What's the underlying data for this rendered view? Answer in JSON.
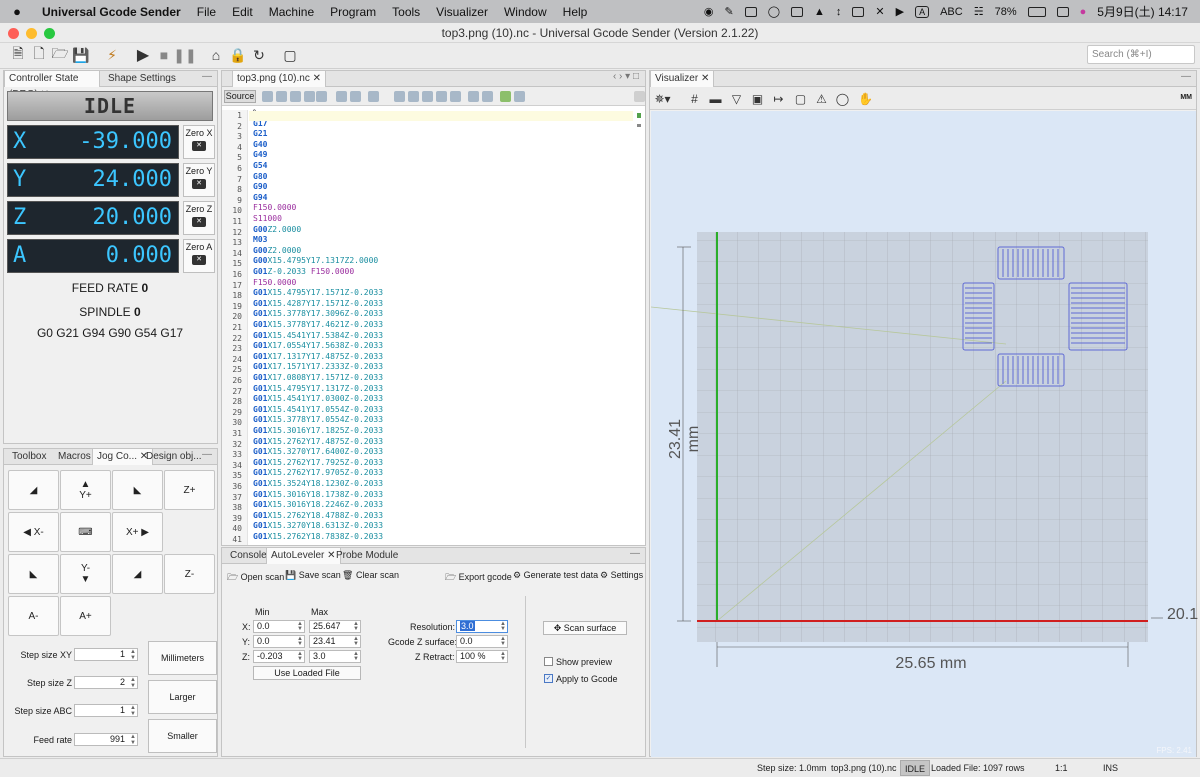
{
  "menubar": {
    "app_name": "Universal Gcode Sender",
    "items": [
      "File",
      "Edit",
      "Machine",
      "Program",
      "Tools",
      "Visualizer",
      "Window",
      "Help"
    ],
    "input_mode": "ABC",
    "battery": "78%",
    "clock": "5月9日(土)  14:17"
  },
  "window": {
    "title": "top3.png (10).nc - Universal Gcode Sender (Version 2.1.22)"
  },
  "toolbar": {
    "search_placeholder": "Search (⌘+I)"
  },
  "left_top": {
    "tabs": [
      "Controller State (DRO)",
      "Shape Settings"
    ],
    "state": "IDLE",
    "axes": [
      {
        "name": "X",
        "value": "-39.000",
        "zero_label": "Zero X"
      },
      {
        "name": "Y",
        "value": "24.000",
        "zero_label": "Zero Y"
      },
      {
        "name": "Z",
        "value": "20.000",
        "zero_label": "Zero Z"
      },
      {
        "name": "A",
        "value": "0.000",
        "zero_label": "Zero A"
      }
    ],
    "feed_rate_label": "FEED RATE",
    "feed_rate_value": "0",
    "spindle_label": "SPINDLE",
    "spindle_value": "0",
    "gcode_state": "G0 G21 G94 G90 G54 G17"
  },
  "left_bottom": {
    "tabs": [
      "Toolbox",
      "Macros",
      "Jog Co...",
      "Design obj..."
    ],
    "jog": {
      "y_plus": "Y+",
      "z_plus": "Z+",
      "x_minus": "X-",
      "x_plus": "X+",
      "y_minus": "Y-",
      "z_minus": "Z-",
      "a_minus": "A-",
      "a_plus": "A+"
    },
    "step_xy_label": "Step size XY",
    "step_xy": "1",
    "step_z_label": "Step size Z",
    "step_z": "2",
    "step_abc_label": "Step size ABC",
    "step_abc": "1",
    "feed_label": "Feed rate",
    "feed": "991",
    "millimeters": "Millimeters",
    "larger": "Larger",
    "smaller": "Smaller"
  },
  "editor": {
    "tab": "top3.png (10).nc",
    "source_button": "Source",
    "lines": [
      {
        "n": "1",
        "parts": [
          {
            "t": "%",
            "c": ""
          }
        ]
      },
      {
        "n": "2",
        "parts": [
          {
            "t": "G17",
            "c": "kw"
          }
        ]
      },
      {
        "n": "3",
        "parts": [
          {
            "t": "G21",
            "c": "kw"
          }
        ]
      },
      {
        "n": "4",
        "parts": [
          {
            "t": "G40",
            "c": "kw"
          }
        ]
      },
      {
        "n": "5",
        "parts": [
          {
            "t": "G49",
            "c": "kw"
          }
        ]
      },
      {
        "n": "6",
        "parts": [
          {
            "t": "G54",
            "c": "kw"
          }
        ]
      },
      {
        "n": "7",
        "parts": [
          {
            "t": "G80",
            "c": "kw"
          }
        ]
      },
      {
        "n": "8",
        "parts": [
          {
            "t": "G90",
            "c": "kw"
          }
        ]
      },
      {
        "n": "9",
        "parts": [
          {
            "t": "G94",
            "c": "kw"
          }
        ]
      },
      {
        "n": "10",
        "parts": [
          {
            "t": "F150.0000",
            "c": "fs"
          }
        ]
      },
      {
        "n": "11",
        "parts": [
          {
            "t": "S11000",
            "c": "fs"
          }
        ]
      },
      {
        "n": "12",
        "parts": [
          {
            "t": "G00",
            "c": "kw"
          },
          {
            "t": "Z2.0000",
            "c": "arg"
          }
        ]
      },
      {
        "n": "13",
        "parts": [
          {
            "t": "M03",
            "c": "kw"
          }
        ]
      },
      {
        "n": "14",
        "parts": [
          {
            "t": "G00",
            "c": "kw"
          },
          {
            "t": "Z2.0000",
            "c": "arg"
          }
        ]
      },
      {
        "n": "15",
        "parts": [
          {
            "t": "G00",
            "c": "kw"
          },
          {
            "t": "X15.4795Y17.1317Z2.0000",
            "c": "arg"
          }
        ]
      },
      {
        "n": "16",
        "parts": [
          {
            "t": "G01",
            "c": "kw"
          },
          {
            "t": "Z-0.2033 ",
            "c": "arg"
          },
          {
            "t": "F150.0000",
            "c": "fs"
          }
        ]
      },
      {
        "n": "17",
        "parts": [
          {
            "t": "F150.0000",
            "c": "fs"
          }
        ]
      },
      {
        "n": "18",
        "parts": [
          {
            "t": "G01",
            "c": "kw"
          },
          {
            "t": "X15.4795Y17.1571Z-0.2033",
            "c": "arg"
          }
        ]
      },
      {
        "n": "19",
        "parts": [
          {
            "t": "G01",
            "c": "kw"
          },
          {
            "t": "X15.4287Y17.1571Z-0.2033",
            "c": "arg"
          }
        ]
      },
      {
        "n": "20",
        "parts": [
          {
            "t": "G01",
            "c": "kw"
          },
          {
            "t": "X15.3778Y17.3096Z-0.2033",
            "c": "arg"
          }
        ]
      },
      {
        "n": "21",
        "parts": [
          {
            "t": "G01",
            "c": "kw"
          },
          {
            "t": "X15.3778Y17.4621Z-0.2033",
            "c": "arg"
          }
        ]
      },
      {
        "n": "22",
        "parts": [
          {
            "t": "G01",
            "c": "kw"
          },
          {
            "t": "X15.4541Y17.5384Z-0.2033",
            "c": "arg"
          }
        ]
      },
      {
        "n": "23",
        "parts": [
          {
            "t": "G01",
            "c": "kw"
          },
          {
            "t": "X17.0554Y17.5638Z-0.2033",
            "c": "arg"
          }
        ]
      },
      {
        "n": "24",
        "parts": [
          {
            "t": "G01",
            "c": "kw"
          },
          {
            "t": "X17.1317Y17.4875Z-0.2033",
            "c": "arg"
          }
        ]
      },
      {
        "n": "25",
        "parts": [
          {
            "t": "G01",
            "c": "kw"
          },
          {
            "t": "X17.1571Y17.2333Z-0.2033",
            "c": "arg"
          }
        ]
      },
      {
        "n": "26",
        "parts": [
          {
            "t": "G01",
            "c": "kw"
          },
          {
            "t": "X17.0808Y17.1571Z-0.2033",
            "c": "arg"
          }
        ]
      },
      {
        "n": "27",
        "parts": [
          {
            "t": "G01",
            "c": "kw"
          },
          {
            "t": "X15.4795Y17.1317Z-0.2033",
            "c": "arg"
          }
        ]
      },
      {
        "n": "28",
        "parts": [
          {
            "t": "G01",
            "c": "kw"
          },
          {
            "t": "X15.4541Y17.0300Z-0.2033",
            "c": "arg"
          }
        ]
      },
      {
        "n": "29",
        "parts": [
          {
            "t": "G01",
            "c": "kw"
          },
          {
            "t": "X15.4541Y17.0554Z-0.2033",
            "c": "arg"
          }
        ]
      },
      {
        "n": "30",
        "parts": [
          {
            "t": "G01",
            "c": "kw"
          },
          {
            "t": "X15.3778Y17.0554Z-0.2033",
            "c": "arg"
          }
        ]
      },
      {
        "n": "31",
        "parts": [
          {
            "t": "G01",
            "c": "kw"
          },
          {
            "t": "X15.3016Y17.1825Z-0.2033",
            "c": "arg"
          }
        ]
      },
      {
        "n": "32",
        "parts": [
          {
            "t": "G01",
            "c": "kw"
          },
          {
            "t": "X15.2762Y17.4875Z-0.2033",
            "c": "arg"
          }
        ]
      },
      {
        "n": "33",
        "parts": [
          {
            "t": "G01",
            "c": "kw"
          },
          {
            "t": "X15.3270Y17.6400Z-0.2033",
            "c": "arg"
          }
        ]
      },
      {
        "n": "34",
        "parts": [
          {
            "t": "G01",
            "c": "kw"
          },
          {
            "t": "X15.2762Y17.7925Z-0.2033",
            "c": "arg"
          }
        ]
      },
      {
        "n": "35",
        "parts": [
          {
            "t": "G01",
            "c": "kw"
          },
          {
            "t": "X15.2762Y17.9705Z-0.2033",
            "c": "arg"
          }
        ]
      },
      {
        "n": "36",
        "parts": [
          {
            "t": "G01",
            "c": "kw"
          },
          {
            "t": "X15.3524Y18.1230Z-0.2033",
            "c": "arg"
          }
        ]
      },
      {
        "n": "37",
        "parts": [
          {
            "t": "G01",
            "c": "kw"
          },
          {
            "t": "X15.3016Y18.1738Z-0.2033",
            "c": "arg"
          }
        ]
      },
      {
        "n": "38",
        "parts": [
          {
            "t": "G01",
            "c": "kw"
          },
          {
            "t": "X15.3016Y18.2246Z-0.2033",
            "c": "arg"
          }
        ]
      },
      {
        "n": "39",
        "parts": [
          {
            "t": "G01",
            "c": "kw"
          },
          {
            "t": "X15.2762Y18.4788Z-0.2033",
            "c": "arg"
          }
        ]
      },
      {
        "n": "40",
        "parts": [
          {
            "t": "G01",
            "c": "kw"
          },
          {
            "t": "X15.3270Y18.6313Z-0.2033",
            "c": "arg"
          }
        ]
      },
      {
        "n": "41",
        "parts": [
          {
            "t": "G01",
            "c": "kw"
          },
          {
            "t": "X15.2762Y18.7838Z-0.2033",
            "c": "arg"
          }
        ]
      }
    ]
  },
  "autoleveler": {
    "tabs": [
      "Console",
      "AutoLeveler",
      "Probe Module"
    ],
    "open_scan": "Open scan",
    "save_scan": "Save scan",
    "clear_scan": "Clear scan",
    "export_gcode": "Export gcode",
    "generate_test": "Generate test data",
    "settings": "Settings",
    "min_label": "Min",
    "max_label": "Max",
    "x_label": "X:",
    "x_min": "0.0",
    "x_max": "25.647",
    "y_label": "Y:",
    "y_min": "0.0",
    "y_max": "23.41",
    "z_label": "Z:",
    "z_min": "-0.203",
    "z_max": "3.0",
    "use_loaded": "Use Loaded File",
    "resolution_label": "Resolution:",
    "resolution": "3.0",
    "gcode_z_label": "Gcode Z surface:",
    "gcode_z": "0.0",
    "z_retract_label": "Z Retract:",
    "z_retract": "100 %",
    "scan_surface": "Scan surface",
    "show_preview": "Show preview",
    "apply_to_gcode": "Apply to Gcode",
    "apply_checked": "✓"
  },
  "visualizer": {
    "tab": "Visualizer",
    "units": "MM",
    "dim_y": "23.41 mm",
    "dim_x": "25.65 mm",
    "dim_z": "20.1",
    "fps": "FPS: 2.41"
  },
  "statusbar": {
    "step_size": "Step size: 1.0mm",
    "file": "top3.png (10).nc",
    "state": "IDLE",
    "loaded": "Loaded File: 1097 rows",
    "ratio": "1:1",
    "mode": "INS"
  }
}
